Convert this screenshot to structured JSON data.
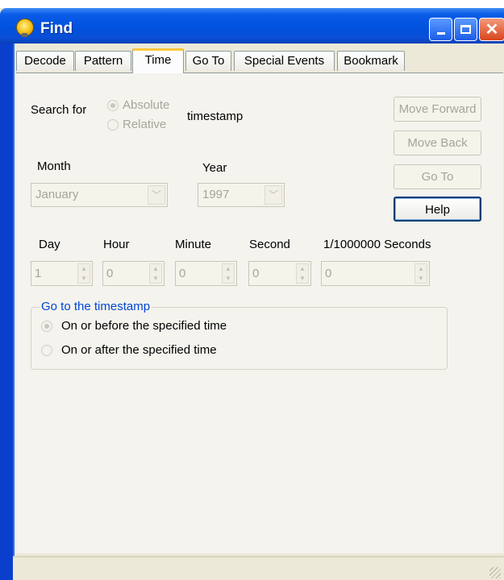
{
  "window": {
    "title": "Find"
  },
  "tabs": [
    {
      "label": "Decode"
    },
    {
      "label": "Pattern"
    },
    {
      "label": "Time"
    },
    {
      "label": "Go To"
    },
    {
      "label": "Special Events"
    },
    {
      "label": "Bookmark"
    }
  ],
  "search": {
    "label": "Search for",
    "options": [
      "Absolute",
      "Relative"
    ],
    "selected": "Absolute",
    "suffix": "timestamp"
  },
  "date": {
    "month_label": "Month",
    "month_value": "January",
    "year_label": "Year",
    "year_value": "1997"
  },
  "buttons": {
    "move_forward": "Move Forward",
    "move_back": "Move Back",
    "go_to": "Go To",
    "help": "Help"
  },
  "time_fields": [
    {
      "label": "Day",
      "value": "1"
    },
    {
      "label": "Hour",
      "value": "0"
    },
    {
      "label": "Minute",
      "value": "0"
    },
    {
      "label": "Second",
      "value": "0"
    },
    {
      "label": "1/1000000 Seconds",
      "value": "0"
    }
  ],
  "goto_group": {
    "title": "Go to the timestamp",
    "options": [
      "On or before the specified time",
      "On or after the specified time"
    ],
    "selected": "On or before the specified time"
  },
  "colors": {
    "titlebar": "#0051dd",
    "active_tab_highlight": "#ffc73c",
    "group_title": "#0046d5",
    "disabled_text": "#a6a49b"
  }
}
